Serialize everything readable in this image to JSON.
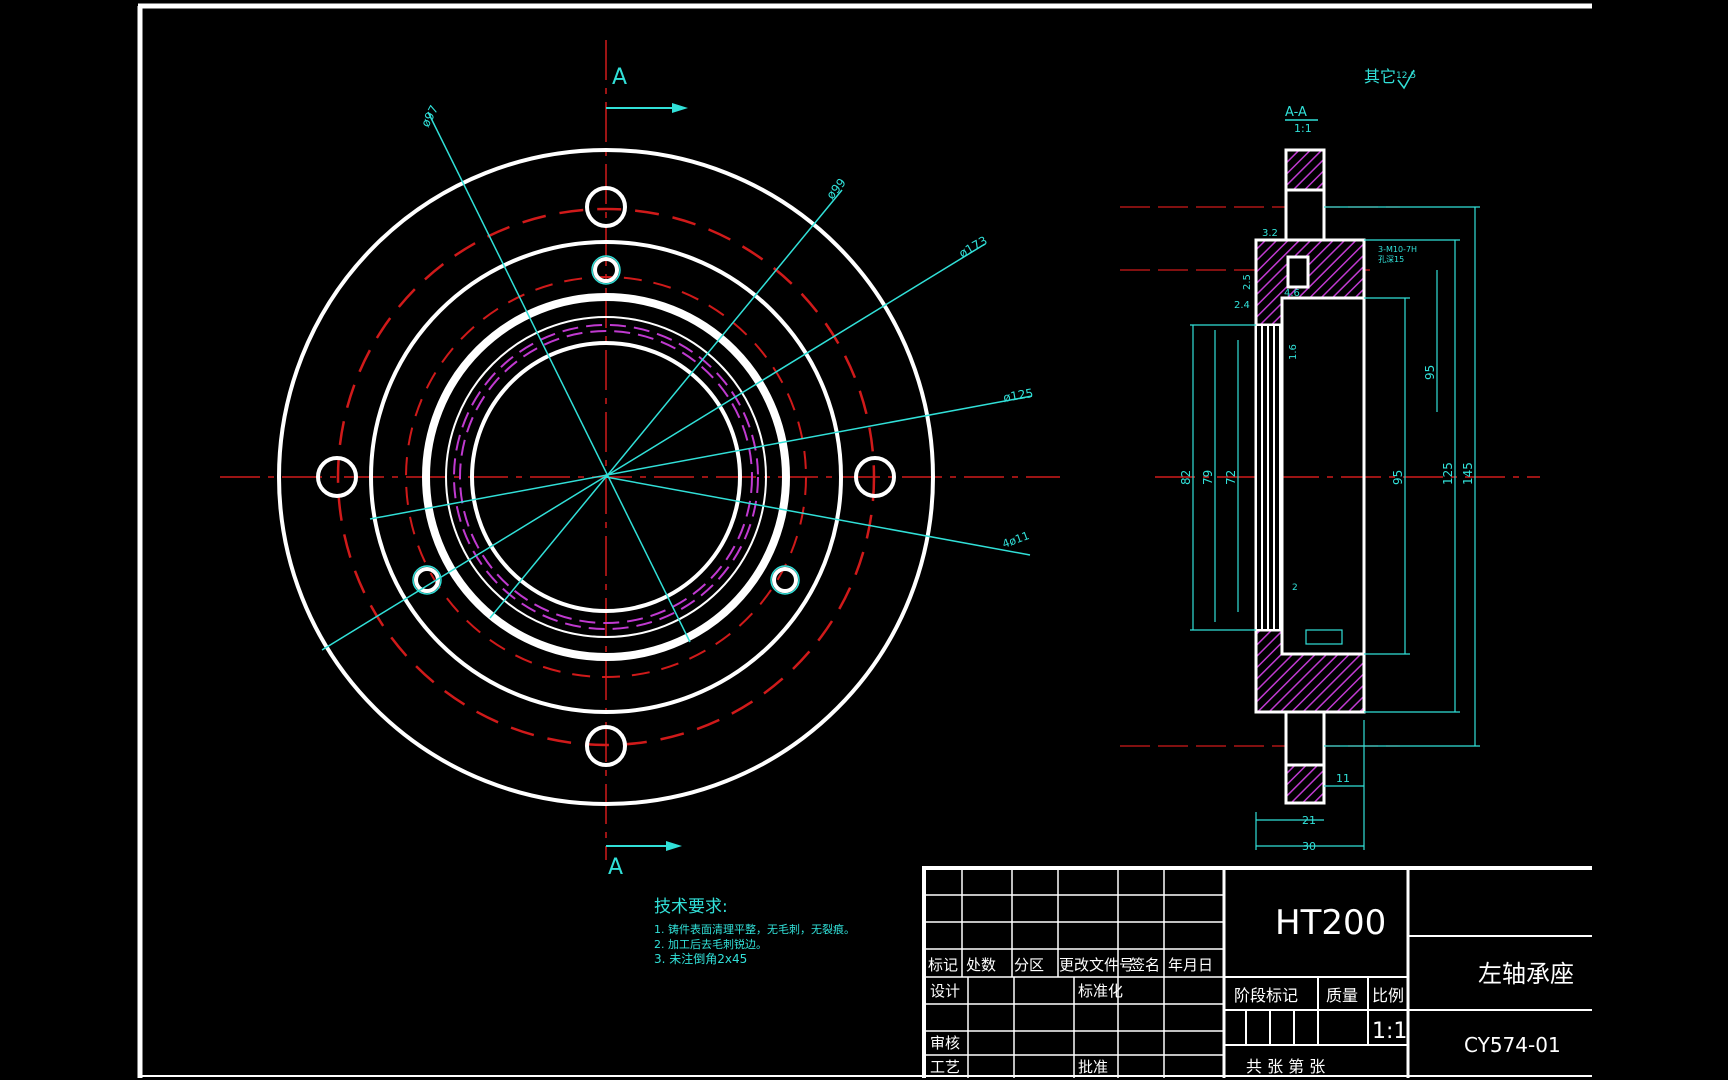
{
  "drawing": {
    "material": "HT200",
    "part_name": "左轴承座",
    "drawing_number": "CY574-01",
    "scale": "1:1",
    "surface_finish_note": "其它",
    "surface_finish_value": "12.5"
  },
  "section": {
    "marker": "A",
    "title": "A-A",
    "title_scale": "1:1"
  },
  "front_view_dims": {
    "d97": "ø97",
    "d99": "ø99",
    "d173": "ø173",
    "d125": "ø125",
    "holes": "4ø11"
  },
  "side_view_dims": {
    "d32": "3.2",
    "d25": "2.5",
    "d24": "2.4",
    "d46": "4.6",
    "d16": "1.6",
    "thread": "3-M10-7H",
    "thread_depth": "孔深15",
    "v82": "82",
    "v79": "79",
    "v72": "72",
    "v95": "95",
    "v95b": "95",
    "v125": "125",
    "v145": "145",
    "h11": "11",
    "h21": "21",
    "h30": "30",
    "h2": "2"
  },
  "tech_requirements": {
    "title": "技术要求:",
    "items": [
      "1. 铸件表面清理平整，无毛刺，无裂痕。",
      "2. 加工后去毛刺锐边。",
      "3. 未注倒角2x45"
    ]
  },
  "title_block": {
    "row_labels": [
      "标记",
      "处数",
      "分区",
      "更改文件号",
      "签名",
      "年月日"
    ],
    "design": "设计",
    "standardize": "标准化",
    "review": "审核",
    "process": "工艺",
    "approve": "批准",
    "stage_mark": "阶段标记",
    "weight": "质量",
    "ratio": "比例",
    "sheets": "共 张 第 张"
  }
}
